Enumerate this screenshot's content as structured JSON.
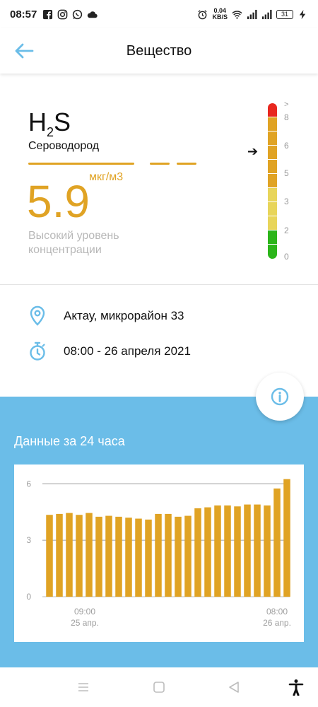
{
  "status_bar": {
    "time": "08:57",
    "net_speed_value": "0.04",
    "net_speed_unit": "KB/S",
    "battery": "31"
  },
  "app_bar": {
    "title": "Вещество"
  },
  "substance": {
    "formula_main": "H",
    "formula_sub": "2",
    "formula_tail": "S",
    "name": "Сероводород",
    "value": "5.9",
    "unit": "мкг/м3",
    "level_text": "Высокий уровень концентрации",
    "scale_labels": [
      ">",
      "8",
      "6",
      "5",
      "3",
      "2",
      "0"
    ],
    "scale_colors": {
      "red": "#e8271f",
      "orange": "#e0a324",
      "yellow": "#e8d55a",
      "green": "#2bb51a"
    }
  },
  "details": {
    "location": "Актау, микрорайон 33",
    "datetime": "08:00 - 26 апреля 2021"
  },
  "chart_section": {
    "title": "Данные за 24 часа"
  },
  "colors": {
    "accent": "#e0a324",
    "blue": "#6bbde8",
    "icon_blue": "#6bbde8"
  },
  "chart_data": {
    "type": "bar",
    "values": [
      4.35,
      4.4,
      4.45,
      4.35,
      4.45,
      4.25,
      4.3,
      4.25,
      4.2,
      4.15,
      4.1,
      4.4,
      4.4,
      4.25,
      4.3,
      4.7,
      4.75,
      4.85,
      4.85,
      4.8,
      4.9,
      4.9,
      4.85,
      5.75,
      6.25
    ],
    "ylim": [
      0,
      6.5
    ],
    "y_ticks": [
      "0",
      "3",
      "6"
    ],
    "x_tick_start": {
      "time": "09:00",
      "date": "25 апр."
    },
    "x_tick_end": {
      "time": "08:00",
      "date": "26 апр."
    },
    "bar_color": "#e0a324",
    "grid": true
  }
}
